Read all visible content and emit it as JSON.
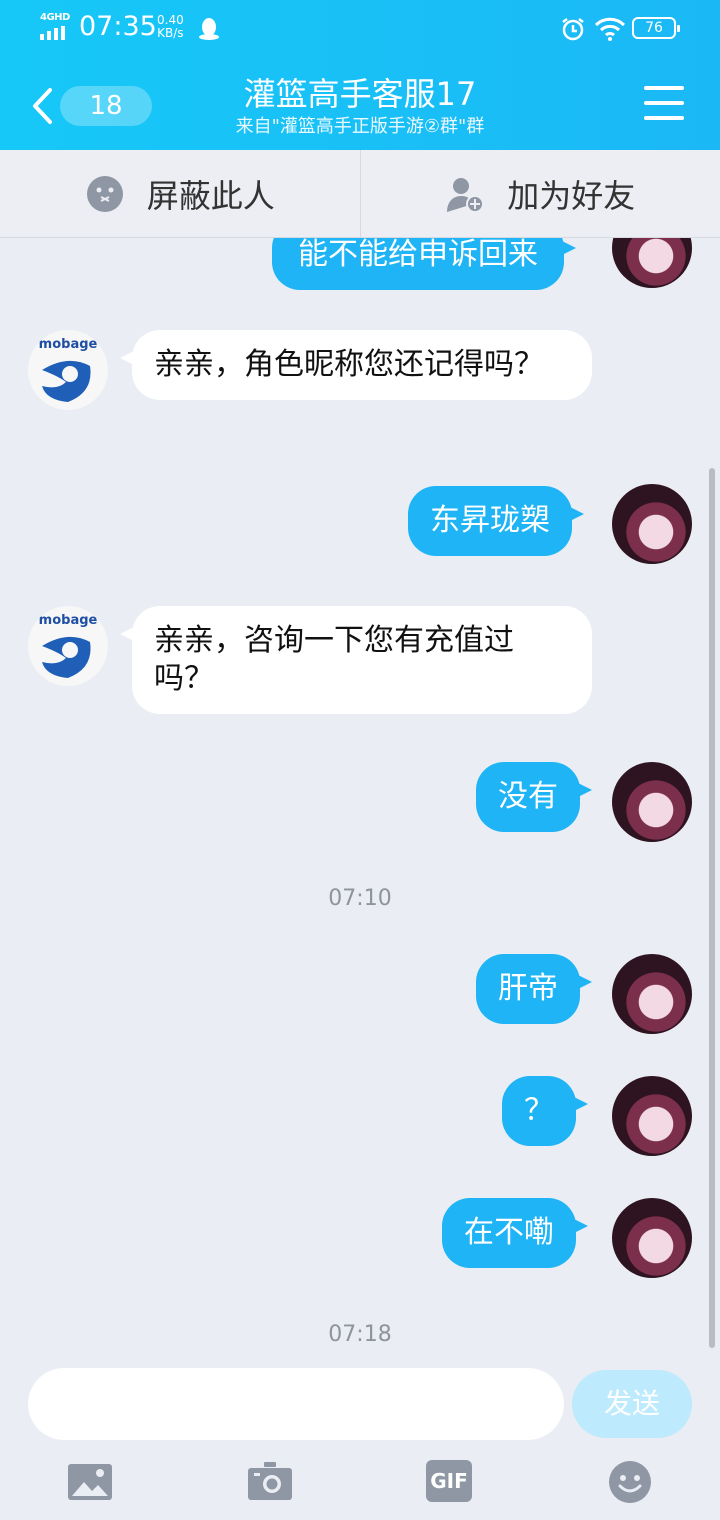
{
  "status_bar": {
    "network": "4GHD",
    "time": "07:35",
    "speed_value": "0.40",
    "speed_unit": "KB/s",
    "battery": "76"
  },
  "header": {
    "back_count": "18",
    "title": "灌篮高手客服17",
    "subtitle": "来自\"灌篮高手正版手游②群\"群"
  },
  "actions": {
    "block_label": "屏蔽此人",
    "add_friend_label": "加为好友"
  },
  "messages": [
    {
      "side": "right",
      "text": "能不能给申诉回来"
    },
    {
      "side": "left",
      "text": "亲亲，角色昵称您还记得吗？"
    },
    {
      "side": "right",
      "text": "东昇珑槊"
    },
    {
      "side": "left",
      "text": "亲亲，咨询一下您有充值过吗？"
    },
    {
      "side": "right",
      "text": "没有"
    },
    {
      "type": "timestamp",
      "text": "07:10"
    },
    {
      "side": "right",
      "text": "肝帝"
    },
    {
      "side": "right",
      "text": "？"
    },
    {
      "side": "right",
      "text": "在不嘞"
    },
    {
      "type": "timestamp",
      "text": "07:18"
    }
  ],
  "avatar_logo": "mobage",
  "input": {
    "placeholder": "",
    "send_label": "发送"
  },
  "toolbar": {
    "gif_label": "GIF"
  },
  "colors": {
    "header": "#16c8f7",
    "my_bubble": "#1fb4f5",
    "their_bubble": "#ffffff",
    "background": "#eaedf4"
  }
}
